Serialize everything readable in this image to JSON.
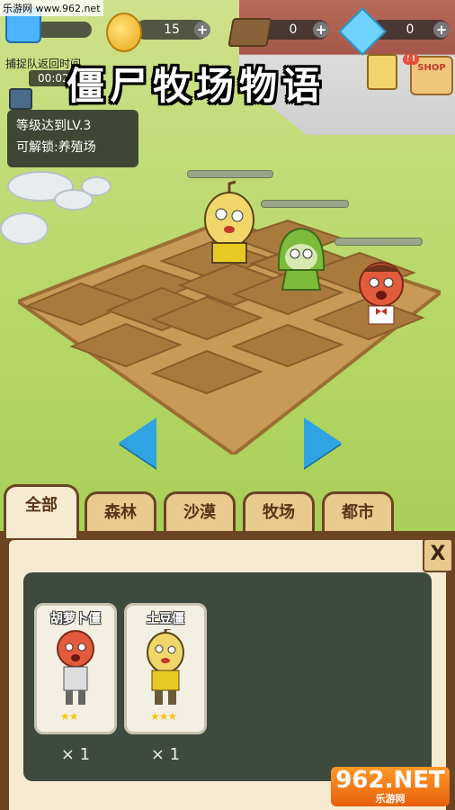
{
  "watermark_top": "乐游网 www.962.net",
  "resources": {
    "coins": "15",
    "wood": "0",
    "gems": "0",
    "plus": "+"
  },
  "capture": {
    "label": "捕捉队返回时间",
    "time": "00:02:46"
  },
  "unlock_hint": {
    "line1": "等级达到LV.3",
    "line2": "可解锁:养殖场"
  },
  "title": "僵尸牧场物语",
  "shop_label": "SHOP",
  "badge_mark": "!",
  "tabs": [
    {
      "label": "全部"
    },
    {
      "label": "森林"
    },
    {
      "label": "沙漠"
    },
    {
      "label": "牧场"
    },
    {
      "label": "都市"
    }
  ],
  "close_label": "X",
  "cards": [
    {
      "name": "胡萝卜僵",
      "stars": "★★",
      "count": "× 1"
    },
    {
      "name": "土豆僵",
      "stars": "★★★",
      "count": "× 1"
    }
  ],
  "logo": {
    "main": "962.NET",
    "sub": "乐游网"
  },
  "colors": {
    "accent_blue": "#2fa4e0",
    "tab_brown": "#6b4522",
    "panel_cream": "#f6ead0",
    "grid_dark": "#3f4a3e"
  }
}
